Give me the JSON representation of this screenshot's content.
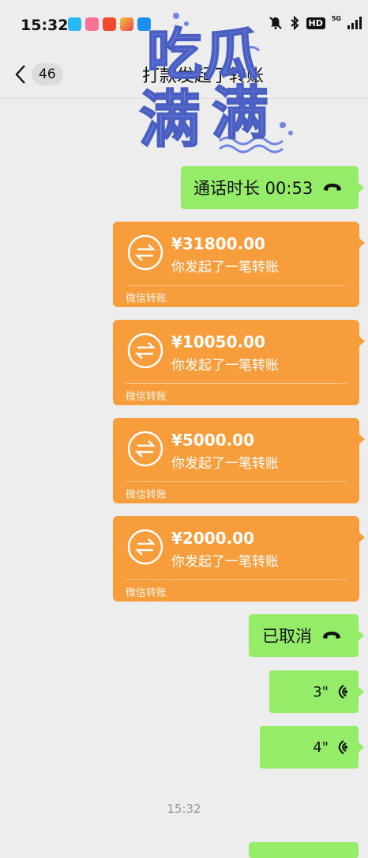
{
  "status_bar": {
    "time": "15:32",
    "network": "5G",
    "hd": "HD"
  },
  "nav": {
    "unread_count": "46",
    "title": "打款发起了转账"
  },
  "sticker": {
    "text": "吃瓜满满"
  },
  "messages": [
    {
      "type": "call",
      "text": "通话时长 00:53"
    },
    {
      "type": "transfer",
      "amount": "¥31800.00",
      "desc": "你发起了一笔转账",
      "footer": "微信转账"
    },
    {
      "type": "transfer",
      "amount": "¥10050.00",
      "desc": "你发起了一笔转账",
      "footer": "微信转账"
    },
    {
      "type": "transfer",
      "amount": "¥5000.00",
      "desc": "你发起了一笔转账",
      "footer": "微信转账"
    },
    {
      "type": "transfer",
      "amount": "¥2000.00",
      "desc": "你发起了一笔转账",
      "footer": "微信转账"
    },
    {
      "type": "call",
      "text": "已取消"
    },
    {
      "type": "voice",
      "duration": "3\""
    },
    {
      "type": "voice",
      "duration": "4\""
    }
  ],
  "timestamp": "15:32",
  "colors": {
    "bubble_green": "#95ec69",
    "transfer_orange": "#f89d3b",
    "background": "#ededed"
  }
}
